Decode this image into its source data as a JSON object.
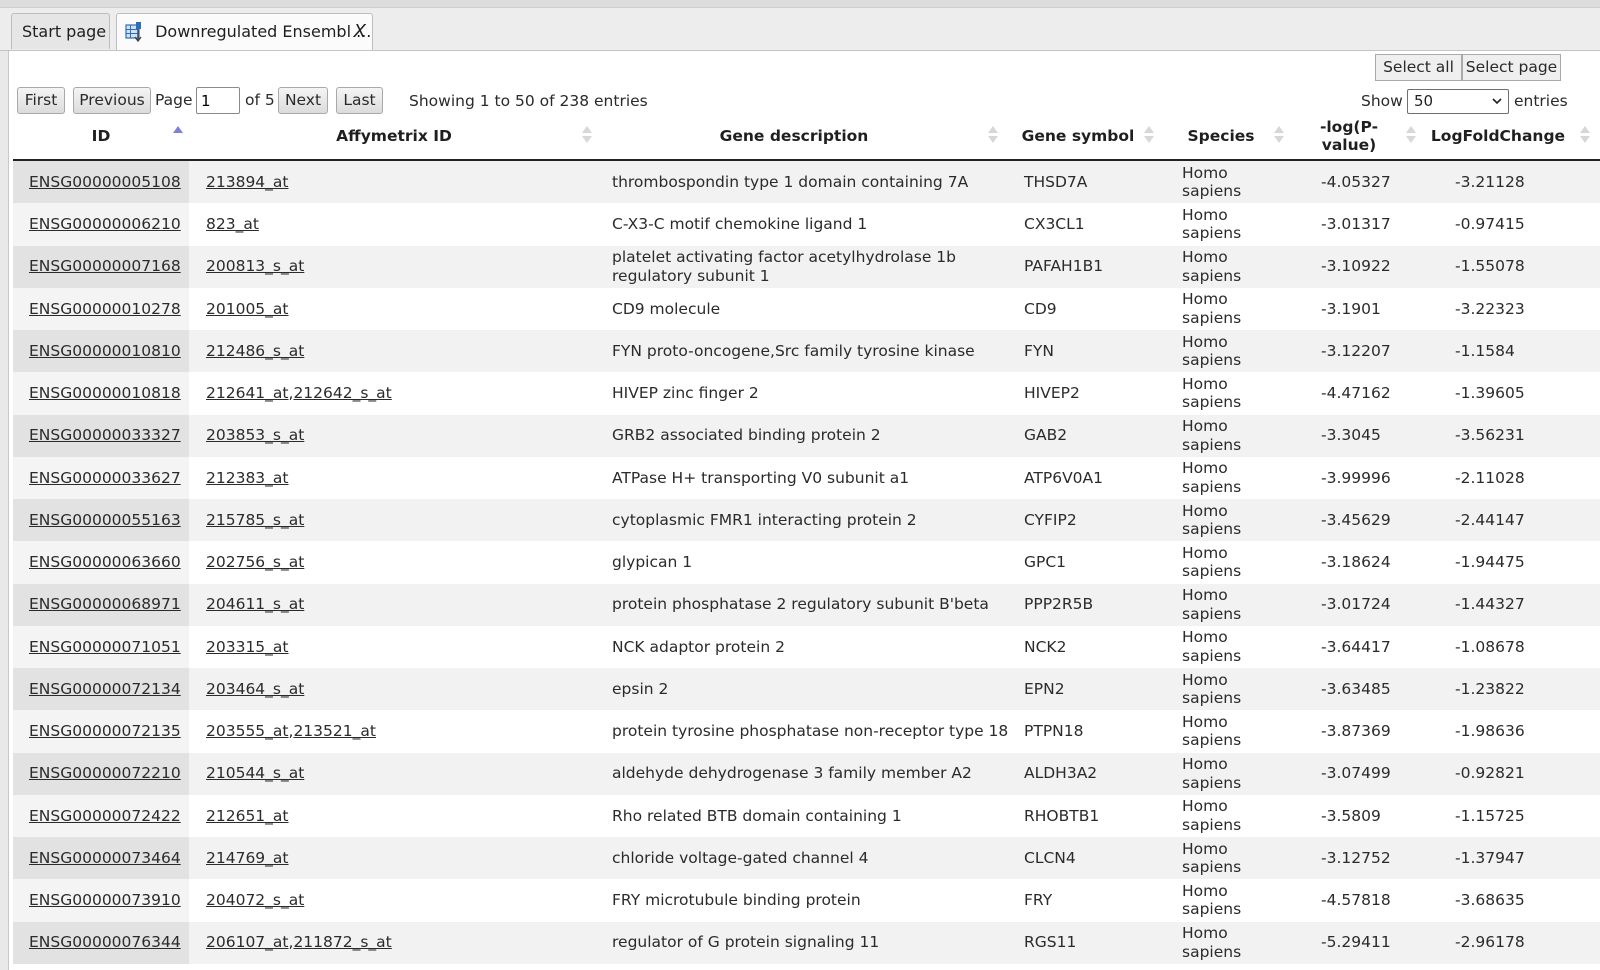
{
  "tabs": {
    "start": "Start page",
    "active": "Downregulated Ensembl ...",
    "close": "X"
  },
  "toolbar": {
    "select_all": "Select all",
    "select_page": "Select page",
    "first": "First",
    "previous": "Previous",
    "page_label": "Page",
    "page_value": "1",
    "of_label": "of 5",
    "next": "Next",
    "last": "Last",
    "showing": "Showing 1 to 50 of 238 entries",
    "show_label": "Show",
    "show_value": "50",
    "entries_label": "entries"
  },
  "table": {
    "headers": [
      "ID",
      "Affymetrix ID",
      "Gene description",
      "Gene symbol",
      "Species",
      "-log(P-value)",
      "LogFoldChange"
    ],
    "header_p_line1": "-log(P-",
    "header_p_line2": "value)",
    "sorted_column": "ID",
    "rows": [
      {
        "id": "ENSG00000005108",
        "aff": [
          "213894_at"
        ],
        "desc": "thrombospondin type 1 domain containing 7A",
        "sym": "THSD7A",
        "sp1": "Homo",
        "sp2": "sapiens",
        "p": "-4.05327",
        "fc": "-3.21128"
      },
      {
        "id": "ENSG00000006210",
        "aff": [
          "823_at"
        ],
        "desc": "C-X3-C motif chemokine ligand 1",
        "sym": "CX3CL1",
        "sp1": "Homo",
        "sp2": "sapiens",
        "p": "-3.01317",
        "fc": "-0.97415"
      },
      {
        "id": "ENSG00000007168",
        "aff": [
          "200813_s_at"
        ],
        "desc": "platelet activating factor acetylhydrolase 1b regulatory subunit 1",
        "sym": "PAFAH1B1",
        "sp1": "Homo",
        "sp2": "sapiens",
        "p": "-3.10922",
        "fc": "-1.55078"
      },
      {
        "id": "ENSG00000010278",
        "aff": [
          "201005_at"
        ],
        "desc": "CD9 molecule",
        "sym": "CD9",
        "sp1": "Homo",
        "sp2": "sapiens",
        "p": "-3.1901",
        "fc": "-3.22323"
      },
      {
        "id": "ENSG00000010810",
        "aff": [
          "212486_s_at"
        ],
        "desc": "FYN proto-oncogene,Src family tyrosine kinase",
        "sym": "FYN",
        "sp1": "Homo",
        "sp2": "sapiens",
        "p": "-3.12207",
        "fc": "-1.1584"
      },
      {
        "id": "ENSG00000010818",
        "aff": [
          "212641_at",
          "212642_s_at"
        ],
        "desc": "HIVEP zinc finger 2",
        "sym": "HIVEP2",
        "sp1": "Homo",
        "sp2": "sapiens",
        "p": "-4.47162",
        "fc": "-1.39605"
      },
      {
        "id": "ENSG00000033327",
        "aff": [
          "203853_s_at"
        ],
        "desc": "GRB2 associated binding protein 2",
        "sym": "GAB2",
        "sp1": "Homo",
        "sp2": "sapiens",
        "p": "-3.3045",
        "fc": "-3.56231"
      },
      {
        "id": "ENSG00000033627",
        "aff": [
          "212383_at"
        ],
        "desc": "ATPase H+ transporting V0 subunit a1",
        "sym": "ATP6V0A1",
        "sp1": "Homo",
        "sp2": "sapiens",
        "p": "-3.99996",
        "fc": "-2.11028"
      },
      {
        "id": "ENSG00000055163",
        "aff": [
          "215785_s_at"
        ],
        "desc": "cytoplasmic FMR1 interacting protein 2",
        "sym": "CYFIP2",
        "sp1": "Homo",
        "sp2": "sapiens",
        "p": "-3.45629",
        "fc": "-2.44147"
      },
      {
        "id": "ENSG00000063660",
        "aff": [
          "202756_s_at"
        ],
        "desc": "glypican 1",
        "sym": "GPC1",
        "sp1": "Homo",
        "sp2": "sapiens",
        "p": "-3.18624",
        "fc": "-1.94475"
      },
      {
        "id": "ENSG00000068971",
        "aff": [
          "204611_s_at"
        ],
        "desc": "protein phosphatase 2 regulatory subunit B'beta",
        "sym": "PPP2R5B",
        "sp1": "Homo",
        "sp2": "sapiens",
        "p": "-3.01724",
        "fc": "-1.44327"
      },
      {
        "id": "ENSG00000071051",
        "aff": [
          "203315_at"
        ],
        "desc": "NCK adaptor protein 2",
        "sym": "NCK2",
        "sp1": "Homo",
        "sp2": "sapiens",
        "p": "-3.64417",
        "fc": "-1.08678"
      },
      {
        "id": "ENSG00000072134",
        "aff": [
          "203464_s_at"
        ],
        "desc": "epsin 2",
        "sym": "EPN2",
        "sp1": "Homo",
        "sp2": "sapiens",
        "p": "-3.63485",
        "fc": "-1.23822"
      },
      {
        "id": "ENSG00000072135",
        "aff": [
          "203555_at",
          "213521_at"
        ],
        "desc": "protein tyrosine phosphatase non-receptor type 18",
        "sym": "PTPN18",
        "sp1": "Homo",
        "sp2": "sapiens",
        "p": "-3.87369",
        "fc": "-1.98636"
      },
      {
        "id": "ENSG00000072210",
        "aff": [
          "210544_s_at"
        ],
        "desc": "aldehyde dehydrogenase 3 family member A2",
        "sym": "ALDH3A2",
        "sp1": "Homo",
        "sp2": "sapiens",
        "p": "-3.07499",
        "fc": "-0.92821"
      },
      {
        "id": "ENSG00000072422",
        "aff": [
          "212651_at"
        ],
        "desc": "Rho related BTB domain containing 1",
        "sym": "RHOBTB1",
        "sp1": "Homo",
        "sp2": "sapiens",
        "p": "-3.5809",
        "fc": "-1.15725"
      },
      {
        "id": "ENSG00000073464",
        "aff": [
          "214769_at"
        ],
        "desc": "chloride voltage-gated channel 4",
        "sym": "CLCN4",
        "sp1": "Homo",
        "sp2": "sapiens",
        "p": "-3.12752",
        "fc": "-1.37947"
      },
      {
        "id": "ENSG00000073910",
        "aff": [
          "204072_s_at"
        ],
        "desc": "FRY microtubule binding protein",
        "sym": "FRY",
        "sp1": "Homo",
        "sp2": "sapiens",
        "p": "-4.57818",
        "fc": "-3.68635"
      },
      {
        "id": "ENSG00000076344",
        "aff": [
          "206107_at",
          "211872_s_at"
        ],
        "desc": "regulator of G protein signaling 11",
        "sym": "RGS11",
        "sp1": "Homo",
        "sp2": "sapiens",
        "p": "-5.29411",
        "fc": "-2.96178"
      }
    ]
  },
  "colors": {
    "sort_active": "#7b83d6",
    "sort_inactive": "#d7d7d7",
    "row_stripe": "#f2f2f2",
    "id_column_shade": "#e2e2e2"
  },
  "icons": {
    "tab_icon": "table-download-icon",
    "select_chevron": "chevron-down-icon"
  }
}
